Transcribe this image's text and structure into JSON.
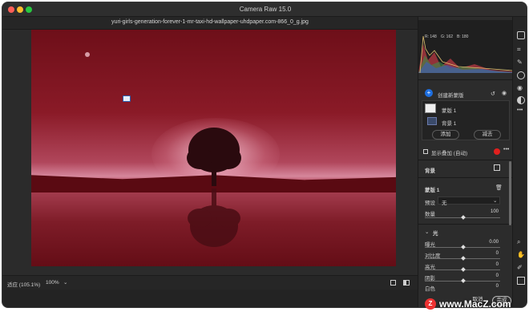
{
  "window": {
    "app_title": "Camera Raw 15.0",
    "filename": "yuri-girls-generation-forever-1-mr-taxi-hd-wallpaper-uhdpaper.com-866_0_g.jpg"
  },
  "histogram": {
    "r_label": "R: 148",
    "g_label": "G: 162",
    "b_label": "B: 180"
  },
  "masks": {
    "create_label": "创建新蒙版",
    "mask_name": "蒙版 1",
    "component_name": "背景 1",
    "add_label": "添加",
    "subtract_label": "减去",
    "overlay_label": "显示叠加 (自动)",
    "background_label": "背景"
  },
  "mask_panel": {
    "title": "蒙版 1",
    "preset_label": "预设",
    "preset_value": "无",
    "amount_label": "数量",
    "amount_value": "100",
    "light_section": "光",
    "sliders": [
      {
        "label": "曝光",
        "value": "0.00"
      },
      {
        "label": "对比度",
        "value": "0"
      },
      {
        "label": "高光",
        "value": "0"
      },
      {
        "label": "阴影",
        "value": "0"
      },
      {
        "label": "白色",
        "value": "0"
      }
    ]
  },
  "bottom": {
    "zoom_label": "适应 (105.1%)",
    "zoom_value": "100%"
  },
  "actions": {
    "cancel": "取消",
    "done": "完成"
  },
  "watermark": {
    "text": "www.MacZ.com"
  },
  "colors": {
    "red_dot": "#e0201e",
    "blue_button": "#1e6fe0",
    "panel": "#2c2c2c"
  }
}
